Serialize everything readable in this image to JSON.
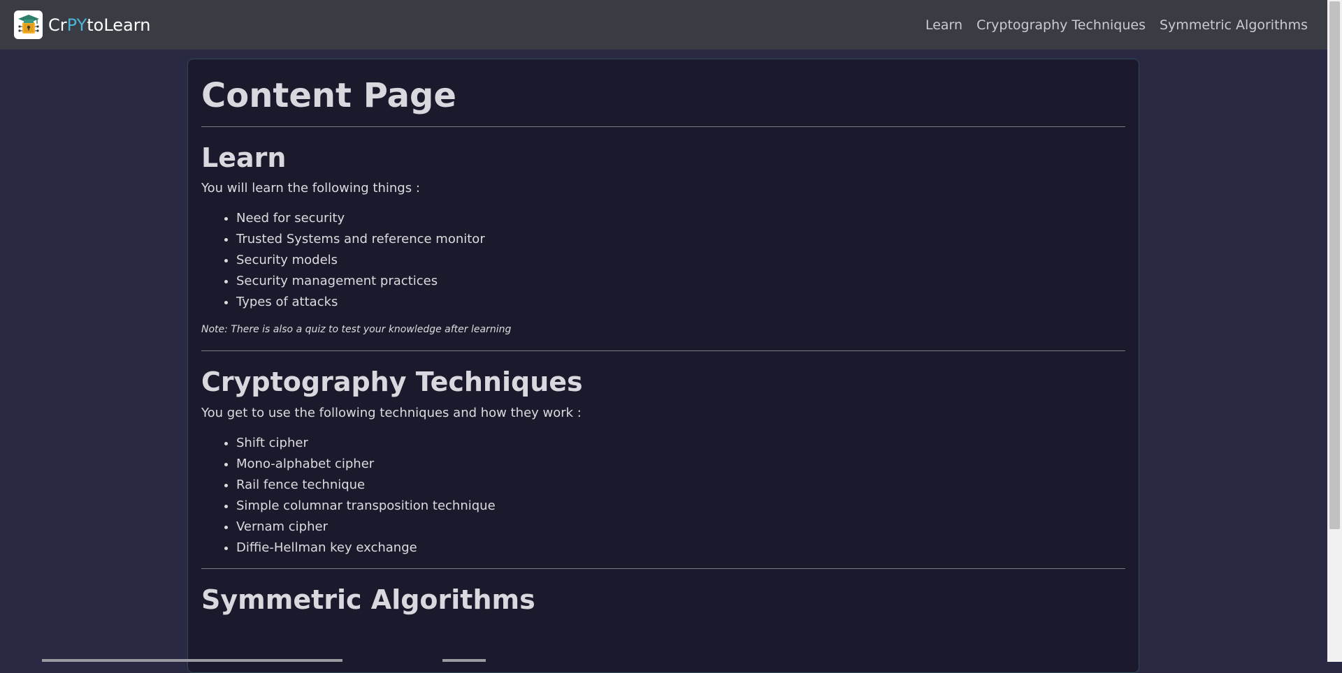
{
  "navbar": {
    "brand_prefix": "Cr",
    "brand_highlight": "PY",
    "brand_suffix": "toLearn",
    "logo_icon": "graduation-cap-lock-icon",
    "links": [
      "Learn",
      "Cryptography Techniques",
      "Symmetric Algorithms"
    ]
  },
  "page": {
    "title": "Content Page",
    "sections": [
      {
        "title": "Learn",
        "intro": "You will learn the following things :",
        "items": [
          "Need for security",
          "Trusted Systems and reference monitor",
          "Security models",
          "Security management practices",
          "Types of attacks"
        ],
        "note": "Note: There is also a quiz to test your knowledge after learning"
      },
      {
        "title": "Cryptography Techniques",
        "intro": "You get to use the following techniques and how they work :",
        "items": [
          "Shift cipher",
          "Mono-alphabet cipher",
          "Rail fence technique",
          "Simple columnar transposition technique",
          "Vernam cipher",
          "Diffie-Hellman key exchange"
        ]
      },
      {
        "title": "Symmetric Algorithms"
      }
    ]
  },
  "colors": {
    "navbar_bg": "#393c43",
    "page_bg": "#2a2944",
    "card_bg": "#1b1a2c",
    "brand_accent": "#4fb3d9"
  }
}
